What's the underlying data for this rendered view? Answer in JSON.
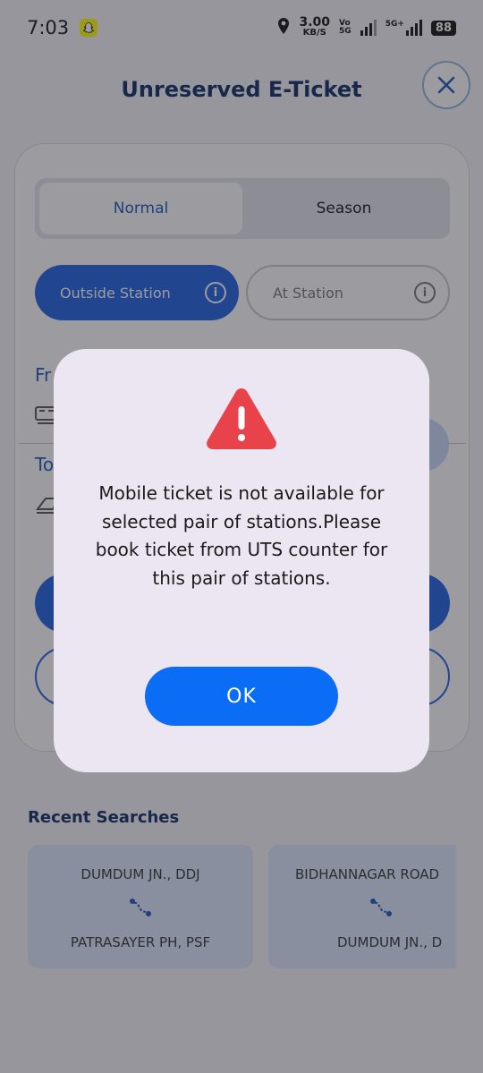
{
  "status_bar": {
    "time": "7:03",
    "speed_value": "3.00",
    "speed_unit": "KB/S",
    "volte_top": "Vo",
    "volte_bottom": "5G",
    "network_5g": "5G+",
    "battery": "88"
  },
  "header": {
    "title": "Unreserved E-Ticket",
    "close_icon": "close-icon"
  },
  "ticket_type": {
    "options": [
      "Normal",
      "Season"
    ],
    "selected": "Normal"
  },
  "booking_mode": {
    "outside_station": "Outside Station",
    "at_station": "At Station",
    "selected": "Outside Station"
  },
  "route_form": {
    "from_label_partial": "Fr",
    "to_label_partial": "To"
  },
  "recent_searches": {
    "title": "Recent Searches",
    "items": [
      {
        "from": "DUMDUM JN., DDJ",
        "to": "PATRASAYER PH, PSF"
      },
      {
        "from": "BIDHANNAGAR ROAD",
        "to": "DUMDUM JN., D"
      }
    ]
  },
  "dialog": {
    "icon": "warning-icon",
    "message": "Mobile ticket is not available for selected pair of stations.Please book ticket from UTS counter for this pair of stations.",
    "ok_label": "OK"
  },
  "colors": {
    "primary": "#1c5fe0",
    "ok_button": "#0b6cf5",
    "warning": "#e8434a",
    "header_text": "#0b2a63"
  }
}
